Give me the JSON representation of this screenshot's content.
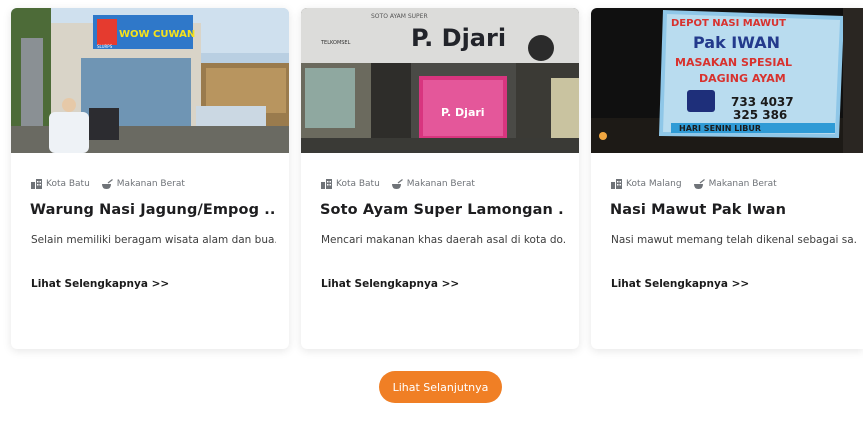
{
  "cards": [
    {
      "city": "Kota Batu",
      "category": "Makanan Berat",
      "title": "Warung Nasi Jagung/Empog ...",
      "description": "Selain memiliki beragam wisata alam dan bua...",
      "link_label": "Lihat Selengkapnya >>",
      "photo": {
        "sign_text": "WOW CUWAN",
        "sub_text": "SLURPS"
      }
    },
    {
      "city": "Kota Batu",
      "category": "Makanan Berat",
      "title": "Soto Ayam Super Lamongan ...",
      "description": "Mencari makanan khas daerah asal di kota do...",
      "link_label": "Lihat Selengkapnya >>",
      "photo": {
        "sign_text": "P. Djari",
        "top_text": "SOTO AYAM SUPER",
        "sub_text": "TELKOMSEL"
      }
    },
    {
      "city": "Kota Malang",
      "category": "Makanan Berat",
      "title": "Nasi Mawut Pak Iwan",
      "description": "Nasi mawut memang telah dikenal sebagai sa...",
      "link_label": "Lihat Selengkapnya >>",
      "photo": {
        "sign_line1": "DEPOT NASI MAWUT",
        "sign_line2": "Pak IWAN",
        "sign_line3": "MASAKAN SPESIAL",
        "sign_line4": "DAGING AYAM",
        "phone1": "733 4037",
        "phone2": "325 386",
        "footer": "HARI SENIN LIBUR"
      }
    }
  ],
  "load_more_label": "Lihat Selanjutnya",
  "colors": {
    "accent": "#f07f25",
    "title": "#1d1d1f",
    "meta": "#6f7378"
  },
  "icons": {
    "city": "city-building-icon",
    "category": "food-bowl-icon"
  }
}
